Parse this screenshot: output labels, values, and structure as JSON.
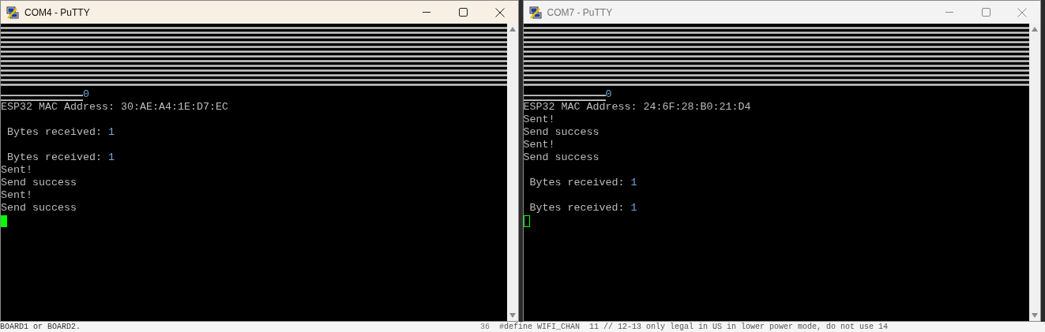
{
  "windows": [
    {
      "title": "COM4 - PuTTY",
      "active": true,
      "terminal": {
        "lines": [
          {
            "text": "ESP32 MAC Address: 30:AE:A4:1E:D7:EC"
          },
          {
            "kind": "blank"
          },
          {
            "kind": "text",
            "text": " Bytes received: ",
            "value": "1"
          },
          {
            "kind": "blank"
          },
          {
            "kind": "text",
            "text": " Bytes received: ",
            "value": "1"
          },
          {
            "text": "Sent!"
          },
          {
            "text": "Send success"
          },
          {
            "text": "Sent!"
          },
          {
            "text": "Send success"
          }
        ],
        "counter": "0",
        "cursor": {
          "focused": true
        }
      }
    },
    {
      "title": "COM7 - PuTTY",
      "active": false,
      "terminal": {
        "lines": [
          {
            "text": "ESP32 MAC Address: 24:6F:28:B0:21:D4"
          },
          {
            "text": "Sent!"
          },
          {
            "text": "Send success"
          },
          {
            "text": "Sent!"
          },
          {
            "text": "Send success"
          },
          {
            "kind": "blank"
          },
          {
            "kind": "text",
            "text": " Bytes received: ",
            "value": "1"
          },
          {
            "kind": "blank"
          },
          {
            "kind": "text",
            "text": " Bytes received: ",
            "value": "1"
          }
        ],
        "counter": "0",
        "cursor": {
          "focused": false
        }
      }
    }
  ],
  "background_editor": {
    "left_text": "BOARD1 or BOARD2.",
    "line_number": "36",
    "code": "#define WIFI_CHAN  11 // 12-13 only legal in US in lower power mode, do not use 14"
  }
}
